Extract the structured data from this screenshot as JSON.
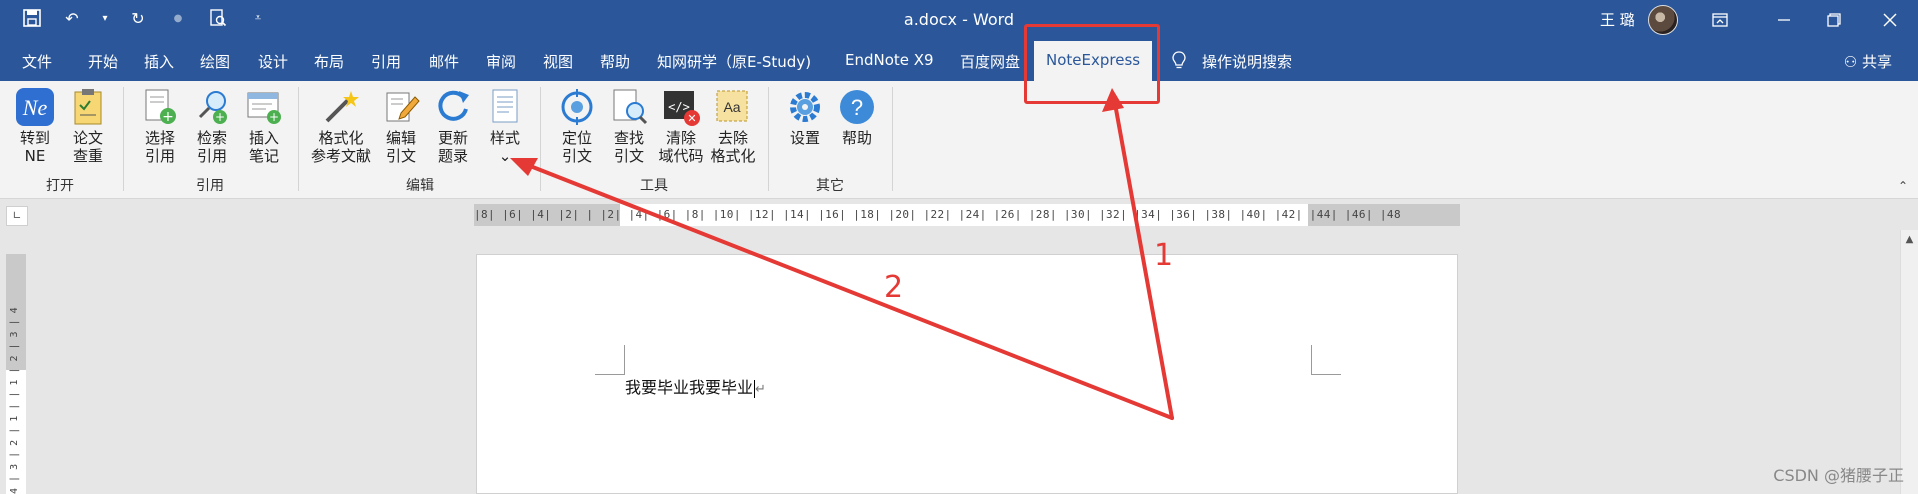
{
  "app": {
    "title": "a.docx  -  Word",
    "user_name": "王 璐"
  },
  "qat": {
    "icons": [
      "save-icon",
      "undo-icon",
      "redo-icon",
      "touch-mode-icon",
      "print-preview-icon",
      "customize-qat-icon"
    ]
  },
  "tabs": [
    {
      "label": "文件"
    },
    {
      "label": "开始"
    },
    {
      "label": "插入"
    },
    {
      "label": "绘图"
    },
    {
      "label": "设计"
    },
    {
      "label": "布局"
    },
    {
      "label": "引用"
    },
    {
      "label": "邮件"
    },
    {
      "label": "审阅"
    },
    {
      "label": "视图"
    },
    {
      "label": "帮助"
    },
    {
      "label": "知网研学（原E-Study)"
    },
    {
      "label": "EndNote X9"
    },
    {
      "label": "百度网盘"
    },
    {
      "label": "NoteExpress"
    },
    {
      "label": "操作说明搜索"
    }
  ],
  "active_tab": "NoteExpress",
  "share_label": "共享",
  "ribbon": {
    "groups": [
      {
        "label": "打开",
        "buttons": [
          {
            "label": "转到\nNE",
            "icon": "ne-logo-icon"
          },
          {
            "label": "论文\n查重",
            "icon": "clipboard-check-icon"
          }
        ]
      },
      {
        "label": "引用",
        "buttons": [
          {
            "label": "选择\n引用",
            "icon": "select-citation-icon"
          },
          {
            "label": "检索\n引用",
            "icon": "search-citation-icon"
          },
          {
            "label": "插入\n笔记",
            "icon": "insert-note-icon"
          }
        ]
      },
      {
        "label": "编辑",
        "buttons": [
          {
            "label": "格式化\n参考文献",
            "icon": "magic-wand-icon"
          },
          {
            "label": "编辑\n引文",
            "icon": "edit-citation-icon"
          },
          {
            "label": "更新\n题录",
            "icon": "refresh-icon"
          },
          {
            "label": "样式\n⌄",
            "icon": "style-icon"
          }
        ]
      },
      {
        "label": "工具",
        "buttons": [
          {
            "label": "定位\n引文",
            "icon": "target-icon"
          },
          {
            "label": "查找\n引文",
            "icon": "find-citation-icon"
          },
          {
            "label": "清除\n域代码",
            "icon": "clear-field-code-icon"
          },
          {
            "label": "去除\n格式化",
            "icon": "remove-format-icon"
          }
        ]
      },
      {
        "label": "其它",
        "buttons": [
          {
            "label": "设置",
            "icon": "gear-icon"
          },
          {
            "label": "帮助",
            "icon": "help-icon"
          }
        ]
      }
    ]
  },
  "ruler": {
    "horizontal": "|8|  |6|  |4|  |2|  |  |2|  |4|  |6|  |8|  |10|  |12|  |14|  |16|  |18|  |20|  |22|  |24|  |26|  |28|  |30|  |32|  |34|  |36|  |38|  |40|  |42|  |44|  |46|  |48",
    "vertical": "4 | 3 | 2 | 1 |  | 1 | 2 | 3 | 4"
  },
  "document": {
    "text": "我要毕业我要毕业"
  },
  "annotations": {
    "label_1": "1",
    "label_2": "2",
    "color": "#e53935"
  },
  "watermark": "CSDN @猪腰子正",
  "colors": {
    "word_blue": "#2b579a",
    "ribbon_bg": "#f3f3f3",
    "annotation_red": "#e53935"
  }
}
